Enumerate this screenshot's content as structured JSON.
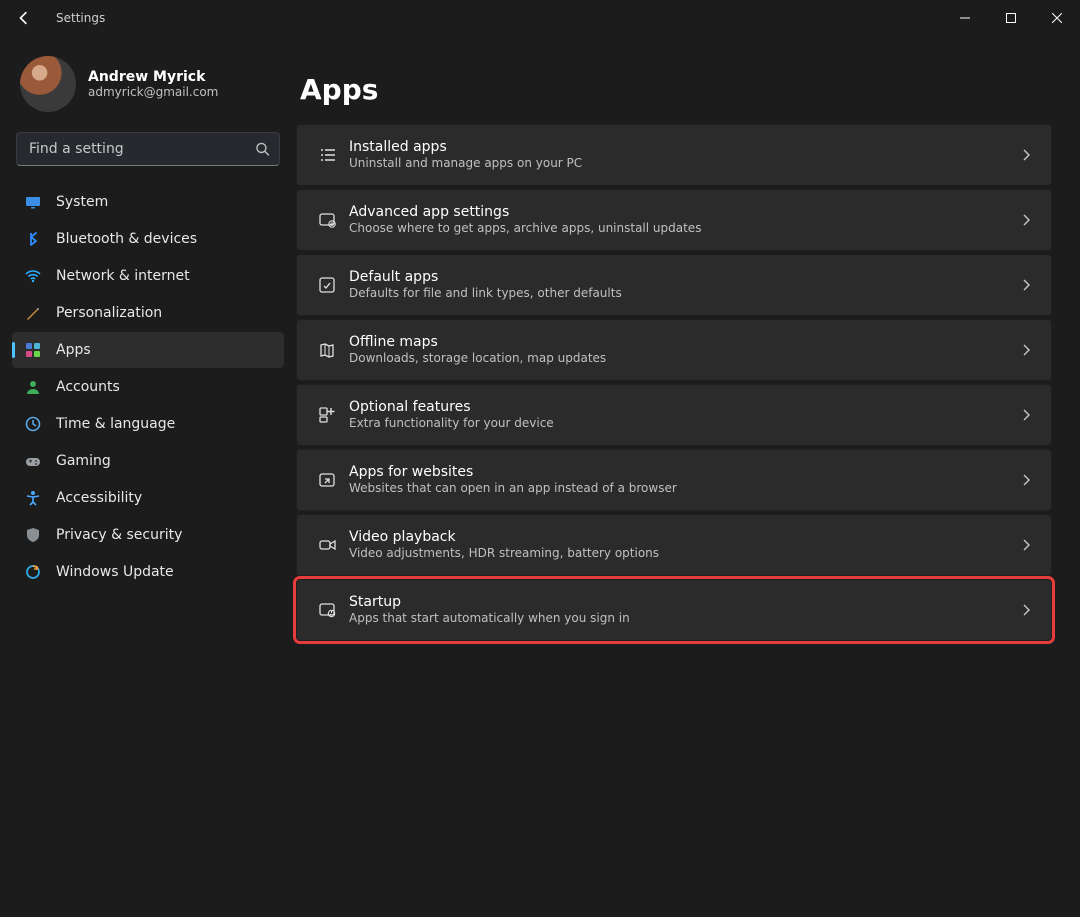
{
  "window": {
    "title": "Settings"
  },
  "user": {
    "name": "Andrew Myrick",
    "email": "admyrick@gmail.com"
  },
  "search": {
    "placeholder": "Find a setting"
  },
  "sidebar": {
    "items": [
      {
        "label": "System",
        "icon": "system",
        "selected": false
      },
      {
        "label": "Bluetooth & devices",
        "icon": "bluetooth",
        "selected": false
      },
      {
        "label": "Network & internet",
        "icon": "wifi",
        "selected": false
      },
      {
        "label": "Personalization",
        "icon": "personalization",
        "selected": false
      },
      {
        "label": "Apps",
        "icon": "apps",
        "selected": true
      },
      {
        "label": "Accounts",
        "icon": "accounts",
        "selected": false
      },
      {
        "label": "Time & language",
        "icon": "time",
        "selected": false
      },
      {
        "label": "Gaming",
        "icon": "gaming",
        "selected": false
      },
      {
        "label": "Accessibility",
        "icon": "accessibility",
        "selected": false
      },
      {
        "label": "Privacy & security",
        "icon": "privacy",
        "selected": false
      },
      {
        "label": "Windows Update",
        "icon": "update",
        "selected": false
      }
    ]
  },
  "page": {
    "title": "Apps",
    "cards": [
      {
        "title": "Installed apps",
        "desc": "Uninstall and manage apps on your PC",
        "icon": "installed",
        "highlight": false
      },
      {
        "title": "Advanced app settings",
        "desc": "Choose where to get apps, archive apps, uninstall updates",
        "icon": "advanced",
        "highlight": false
      },
      {
        "title": "Default apps",
        "desc": "Defaults for file and link types, other defaults",
        "icon": "default",
        "highlight": false
      },
      {
        "title": "Offline maps",
        "desc": "Downloads, storage location, map updates",
        "icon": "maps",
        "highlight": false
      },
      {
        "title": "Optional features",
        "desc": "Extra functionality for your device",
        "icon": "optional",
        "highlight": false
      },
      {
        "title": "Apps for websites",
        "desc": "Websites that can open in an app instead of a browser",
        "icon": "websites",
        "highlight": false
      },
      {
        "title": "Video playback",
        "desc": "Video adjustments, HDR streaming, battery options",
        "icon": "video",
        "highlight": false
      },
      {
        "title": "Startup",
        "desc": "Apps that start automatically when you sign in",
        "icon": "startup",
        "highlight": true
      }
    ]
  }
}
